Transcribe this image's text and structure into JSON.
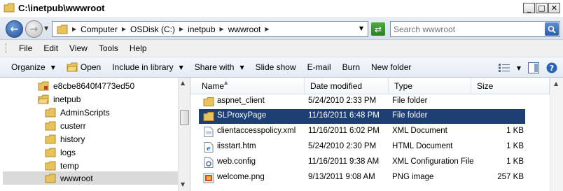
{
  "window": {
    "title": "C:\\inetpub\\wwwroot",
    "minimize": "_",
    "maximize": "□",
    "close": "✕"
  },
  "address": {
    "breadcrumbs": [
      "Computer",
      "OSDisk (C:)",
      "inetpub",
      "wwwroot"
    ],
    "search_placeholder": "Search wwwroot"
  },
  "menu": [
    "File",
    "Edit",
    "View",
    "Tools",
    "Help"
  ],
  "commands": {
    "organize": "Organize",
    "open": "Open",
    "include_in_library": "Include in library",
    "share_with": "Share with",
    "slide_show": "Slide show",
    "email": "E-mail",
    "burn": "Burn",
    "new_folder": "New folder"
  },
  "tree": [
    {
      "label": "e8cbe8640f4773ed50"
    },
    {
      "label": "inetpub"
    },
    {
      "label": "AdminScripts"
    },
    {
      "label": "custerr"
    },
    {
      "label": "history"
    },
    {
      "label": "logs"
    },
    {
      "label": "temp"
    },
    {
      "label": "wwwroot"
    }
  ],
  "columns": {
    "name": "Name",
    "date": "Date modified",
    "type": "Type",
    "size": "Size"
  },
  "files": [
    {
      "name": "aspnet_client",
      "date": "5/24/2010 2:33 PM",
      "type": "File folder",
      "size": "",
      "icon": "folder-icon"
    },
    {
      "name": "SLProxyPage",
      "date": "11/16/2011 6:48 PM",
      "type": "File folder",
      "size": "",
      "icon": "folder-icon"
    },
    {
      "name": "clientaccesspolicy.xml",
      "date": "11/16/2011 6:02 PM",
      "type": "XML Document",
      "size": "1 KB",
      "icon": "xml-file-icon"
    },
    {
      "name": "iisstart.htm",
      "date": "5/24/2010 2:30 PM",
      "type": "HTML Document",
      "size": "1 KB",
      "icon": "html-file-icon"
    },
    {
      "name": "web.config",
      "date": "11/16/2011 9:38 AM",
      "type": "XML Configuration File",
      "size": "1 KB",
      "icon": "config-file-icon"
    },
    {
      "name": "welcome.png",
      "date": "9/13/2011 9:08 AM",
      "type": "PNG image",
      "size": "257 KB",
      "icon": "png-file-icon"
    }
  ],
  "colors": {
    "selection": "#1e3f73",
    "folder": "#e8c25a"
  }
}
